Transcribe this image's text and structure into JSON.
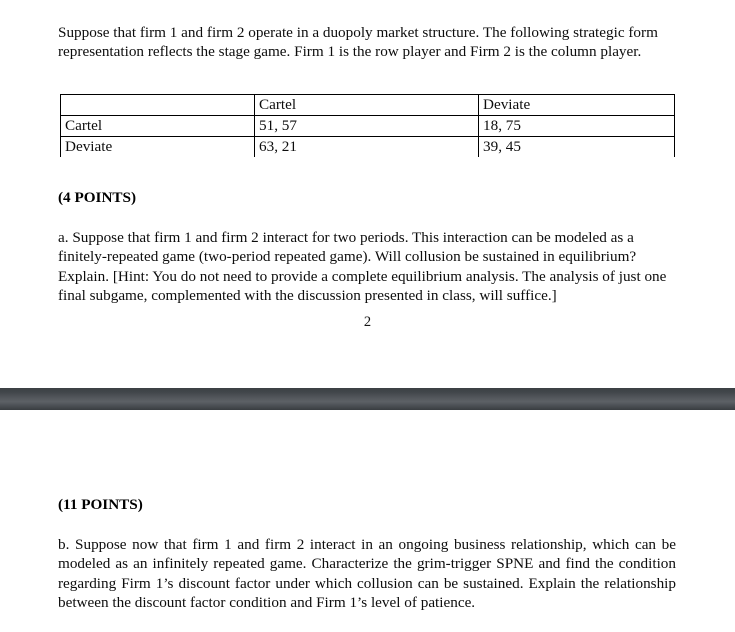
{
  "document": {
    "page_one": {
      "intro_paragraph": "Suppose that firm 1 and firm 2 operate in a duopoly market structure. The following strategic form representation reflects the stage game. Firm 1 is the row player and Firm 2 is the column player.",
      "payoff_matrix": {
        "corner_label": "",
        "column_headers": [
          "Cartel",
          "Deviate"
        ],
        "rows": [
          {
            "label": "Cartel",
            "cells": [
              "51, 57",
              "18, 75"
            ]
          },
          {
            "label": "Deviate",
            "cells": [
              "63, 21",
              "39, 45"
            ]
          }
        ]
      },
      "points_a": "(4 POINTS)",
      "question_a": "a.  Suppose that firm 1 and firm 2 interact for two periods. This interaction can be modeled as a finitely-repeated game (two-period repeated game). Will collusion be sustained in equilibrium? Explain. [Hint: You do not need to provide a complete equilibrium analysis. The analysis of just one final subgame, complemented with the discussion presented in class, will suffice.]",
      "page_number": "2"
    },
    "page_two": {
      "points_b": "(11 POINTS)",
      "question_b": "b. Suppose now that firm 1 and firm 2 interact in an ongoing business relationship, which can be modeled as an infinitely repeated game. Characterize the grim-trigger SPNE and find the condition regarding Firm 1’s discount factor under which collusion can be sustained. Explain  the relationship between the discount factor condition and Firm 1’s level of patience."
    },
    "colors": {
      "page_background": "#ffffff",
      "text": "#0d0d0d",
      "separator_dark": "#3b4044",
      "separator_light": "#5d6166",
      "table_border": "#000000"
    }
  }
}
